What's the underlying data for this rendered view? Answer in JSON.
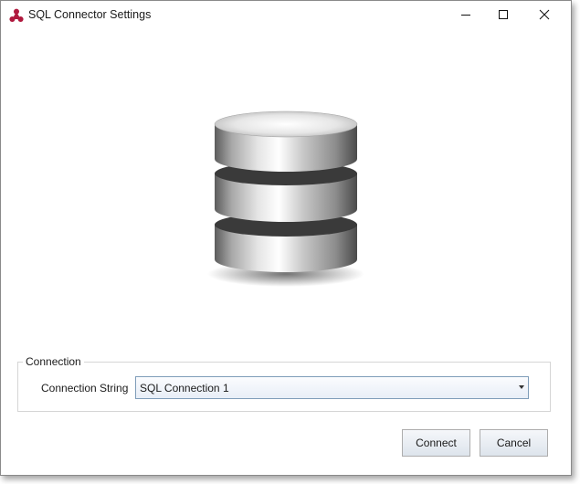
{
  "window": {
    "title": "SQL Connector Settings",
    "icon": "app-logo-icon",
    "accent": "#b0193e"
  },
  "titlebar_buttons": {
    "minimize": "minimize-icon",
    "maximize": "maximize-icon",
    "close": "close-icon"
  },
  "illustration": "database-icon",
  "connection": {
    "group_title": "Connection",
    "label": "Connection String",
    "selected": "SQL Connection 1"
  },
  "footer": {
    "connect_label": "Connect",
    "cancel_label": "Cancel"
  }
}
